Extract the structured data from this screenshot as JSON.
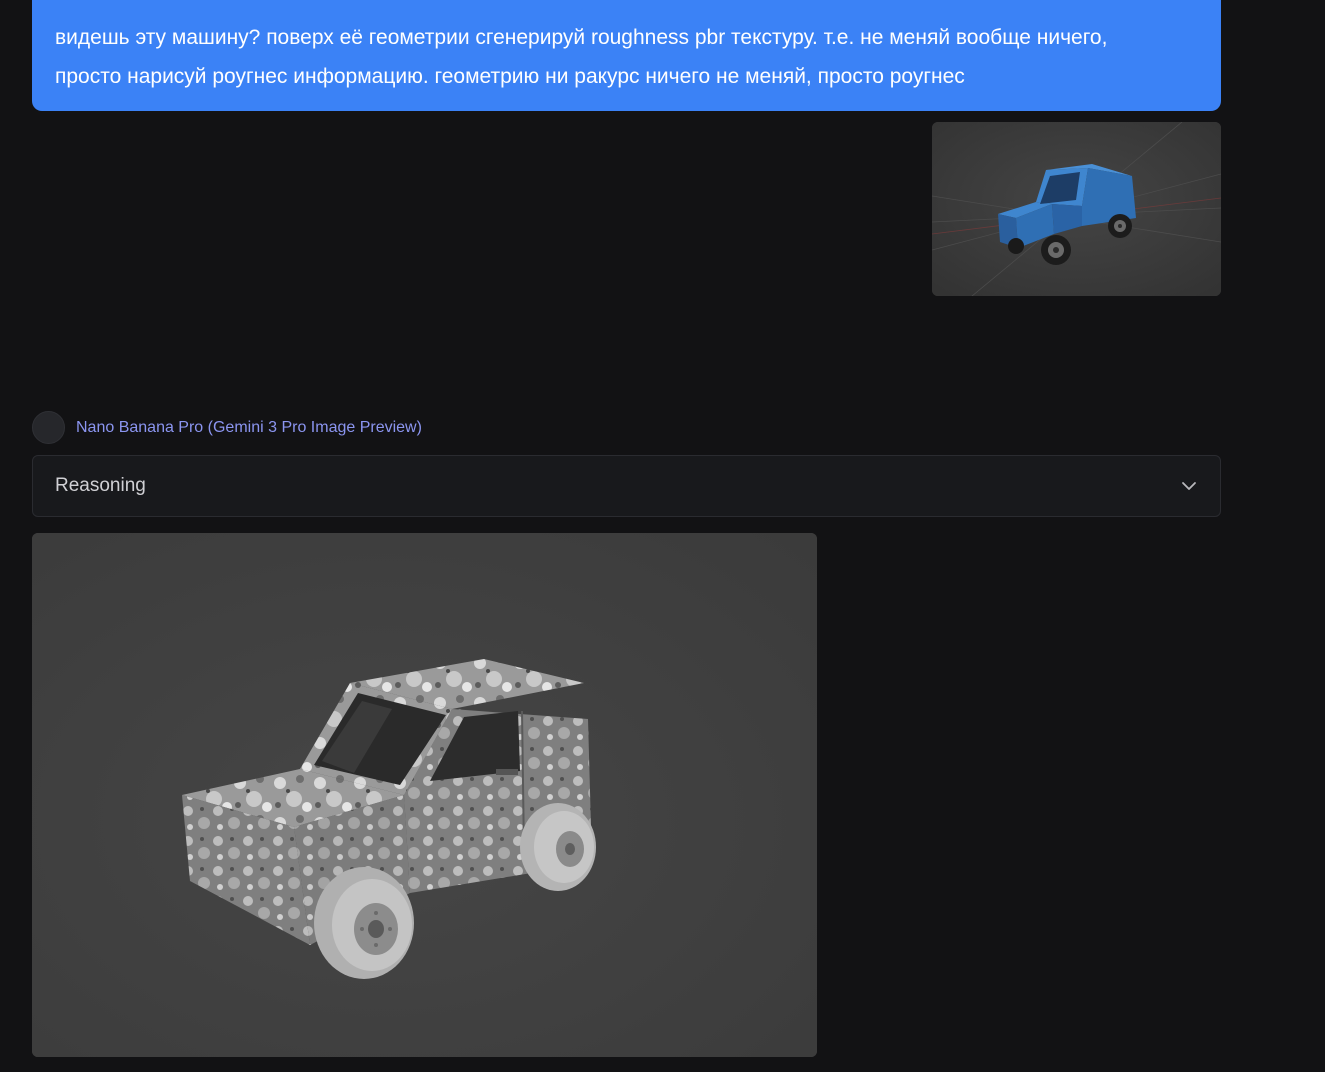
{
  "user_message": {
    "line1": "видешь эту машину? поверх её геометрии сгенерируй roughness pbr текстуру. т.е. не меняй вообще ничего,",
    "line2": "просто нарисуй роугнес информацию. геометрию ни ракурс ничего не меняй, просто роугнес"
  },
  "assistant": {
    "model_name": "Nano Banana Pro (Gemini 3 Pro Image Preview)",
    "reasoning_label": "Reasoning",
    "reasoning_icon": "chevron-down-icon"
  },
  "colors": {
    "background": "#121214",
    "user_bubble": "#3b82f6",
    "model_name": "#8b95f0",
    "car_blue": "#2f6fb4"
  }
}
